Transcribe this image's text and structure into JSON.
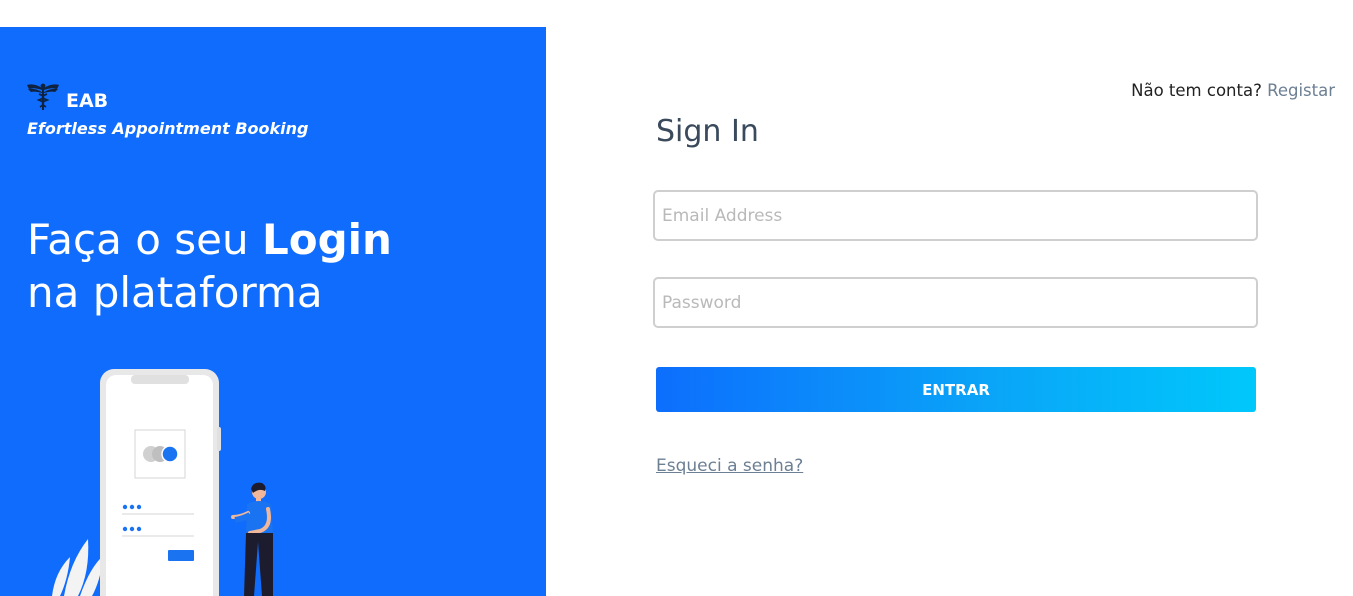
{
  "brand": {
    "logo_icon": "caduceus-icon",
    "name": "EAB",
    "tagline": "Efortless Appointment Booking"
  },
  "hero": {
    "headline_prefix": "Faça o seu ",
    "headline_bold": "Login",
    "headline_line2": "na plataforma",
    "illustration": "phone-login-illustration"
  },
  "signup": {
    "prompt": "Não tem conta?",
    "link_label": "Registar"
  },
  "form": {
    "title": "Sign In",
    "email_placeholder": "Email Address",
    "email_value": "",
    "password_placeholder": "Password",
    "password_value": "",
    "submit_label": "ENTRAR",
    "forgot_label": "Esqueci a senha?"
  },
  "colors": {
    "panel_blue": "#106cfd",
    "button_gradient_start": "#0d6efd",
    "button_gradient_end": "#00c8fb",
    "link_gray": "#6c7f93"
  }
}
